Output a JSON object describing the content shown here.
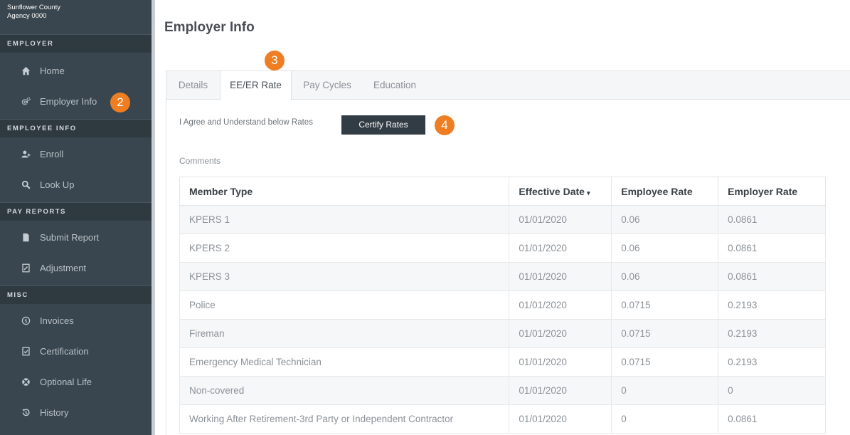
{
  "sidebar": {
    "agency_name": "Sunflower County",
    "agency_id": "Agency 0000",
    "sections": [
      {
        "label": "EMPLOYER",
        "items": [
          {
            "label": "Home",
            "icon": "home-icon"
          },
          {
            "label": "Employer Info",
            "icon": "gears-icon"
          }
        ]
      },
      {
        "label": "EMPLOYEE INFO",
        "items": [
          {
            "label": "Enroll",
            "icon": "user-plus-icon"
          },
          {
            "label": "Look Up",
            "icon": "search-icon"
          }
        ]
      },
      {
        "label": "PAY REPORTS",
        "items": [
          {
            "label": "Submit Report",
            "icon": "file-icon"
          },
          {
            "label": "Adjustment",
            "icon": "edit-file-icon"
          }
        ]
      },
      {
        "label": "MISC",
        "items": [
          {
            "label": "Invoices",
            "icon": "dollar-circle-icon"
          },
          {
            "label": "Certification",
            "icon": "certificate-icon"
          },
          {
            "label": "Optional Life",
            "icon": "lifebuoy-icon"
          },
          {
            "label": "History",
            "icon": "history-icon"
          }
        ]
      }
    ]
  },
  "callouts": {
    "employer_info": "2",
    "tab": "3",
    "certify": "4"
  },
  "page": {
    "title": "Employer Info"
  },
  "tabs": [
    {
      "label": "Details",
      "active": false
    },
    {
      "label": "EE/ER Rate",
      "active": true
    },
    {
      "label": "Pay Cycles",
      "active": false
    },
    {
      "label": "Education",
      "active": false
    }
  ],
  "certify": {
    "agree_text": "I Agree and Understand below Rates",
    "button_label": "Certify Rates",
    "comments_label": "Comments"
  },
  "table": {
    "columns": [
      "Member Type",
      "Effective Date",
      "Employee Rate",
      "Employer Rate"
    ],
    "sort_indicator": "▾",
    "rows": [
      [
        "KPERS 1",
        "01/01/2020",
        "0.06",
        "0.0861"
      ],
      [
        "KPERS 2",
        "01/01/2020",
        "0.06",
        "0.0861"
      ],
      [
        "KPERS 3",
        "01/01/2020",
        "0.06",
        "0.0861"
      ],
      [
        "Police",
        "01/01/2020",
        "0.0715",
        "0.2193"
      ],
      [
        "Fireman",
        "01/01/2020",
        "0.0715",
        "0.2193"
      ],
      [
        "Emergency Medical Technician",
        "01/01/2020",
        "0.0715",
        "0.2193"
      ],
      [
        "Non-covered",
        "01/01/2020",
        "0",
        "0"
      ],
      [
        "Working After Retirement-3rd Party or Independent Contractor",
        "01/01/2020",
        "0",
        "0.0861"
      ]
    ]
  },
  "colors": {
    "sidebar": "#3a464f",
    "accent": "#ef7d22",
    "button": "#313c44"
  }
}
